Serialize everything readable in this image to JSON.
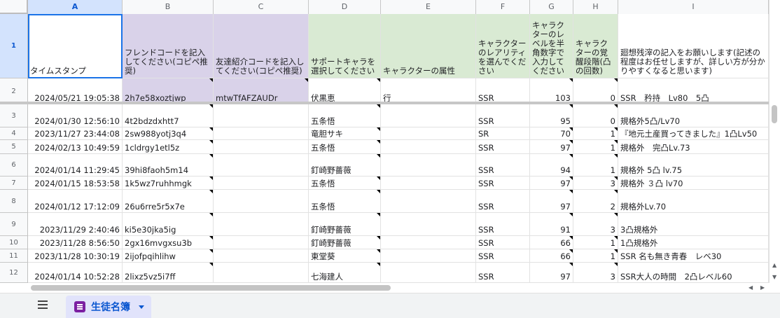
{
  "columns": [
    "A",
    "B",
    "C",
    "D",
    "E",
    "F",
    "G",
    "H",
    "I"
  ],
  "header_row": {
    "row_number": "1",
    "cells": [
      "タイムスタンプ",
      "フレンドコードを記入してください(コピペ推奨)",
      "友達紹介コードを記入してください(コピペ推奨)",
      "サポートキャラを選択してください",
      "キャラクターの属性",
      "キャラクターのレアリティを選んでください",
      "キャラクターのレベルを半角数字で入力してください",
      "キャラクターの覚醒段階(凸の回数)",
      "廻想残滓の記入をお願いします(記述の程度はお任せしますが、詳しい方が分かりやすくなると思います)"
    ]
  },
  "rows": [
    {
      "n": "2",
      "ts": "2024/05/21 19:05:38",
      "friend": "2h7e58xoztjwp",
      "referral": "mtwTfAFZAUDr",
      "chara": "伏黒恵",
      "attr": "行",
      "rarity": "SSR",
      "level": "103",
      "awaken": "0",
      "memo": "SSR　矜持　Lv80　5凸"
    },
    {
      "n": "3",
      "ts": "2024/01/30 12:56:10",
      "friend": "4t2bdzdxhtt7",
      "referral": "",
      "chara": "五条悟",
      "attr": "",
      "rarity": "SSR",
      "level": "95",
      "awaken": "0",
      "memo": "規格外5凸/Lv70"
    },
    {
      "n": "4",
      "ts": "2023/11/27 23:44:08",
      "friend": "2sw988yotj3q4",
      "referral": "",
      "chara": "竜胆サキ",
      "attr": "",
      "rarity": "SR",
      "level": "70",
      "awaken": "1",
      "memo": "『地元土産買ってきました』1凸Lv50"
    },
    {
      "n": "5",
      "ts": "2024/02/13 10:49:59",
      "friend": "1cldrgy1etl5z",
      "referral": "",
      "chara": "五条悟",
      "attr": "",
      "rarity": "SSR",
      "level": "97",
      "awaken": "1",
      "memo": "規格外　完凸Lv.73"
    },
    {
      "n": "6",
      "ts": "2024/01/14 11:29:45",
      "friend": "39hi8faoh5m14",
      "referral": "",
      "chara": "釘崎野薔薇",
      "attr": "",
      "rarity": "SSR",
      "level": "94",
      "awaken": "1",
      "memo": "規格外 5凸 lv.75"
    },
    {
      "n": "7",
      "ts": "2024/01/15 18:53:58",
      "friend": "1k5wz7ruhhmgk",
      "referral": "",
      "chara": "五条悟",
      "attr": "",
      "rarity": "SSR",
      "level": "97",
      "awaken": "3",
      "memo": "規格外 ３凸 lv70"
    },
    {
      "n": "8",
      "ts": "2024/01/12 17:12:09",
      "friend": "26u6rre5r5x7e",
      "referral": "",
      "chara": "五条悟",
      "attr": "",
      "rarity": "SSR",
      "level": "97",
      "awaken": "2",
      "memo": "規格外Lv.70"
    },
    {
      "n": "9",
      "ts": "2023/11/29 2:40:46",
      "friend": "ki5e30jka5ig",
      "referral": "",
      "chara": "釘崎野薔薇",
      "attr": "",
      "rarity": "SSR",
      "level": "91",
      "awaken": "3",
      "memo": "3凸規格外"
    },
    {
      "n": "10",
      "ts": "2023/11/28 8:56:50",
      "friend": "2gx16mvgxsu3b",
      "referral": "",
      "chara": "釘崎野薔薇",
      "attr": "",
      "rarity": "SSR",
      "level": "66",
      "awaken": "1",
      "memo": "1凸規格外"
    },
    {
      "n": "11",
      "ts": "2023/11/28 10:30:19",
      "friend": "2ijofpqihlihw",
      "referral": "",
      "chara": "東堂葵",
      "attr": "",
      "rarity": "SSR",
      "level": "66",
      "awaken": "1",
      "memo": "SSR 名も無き青春　レベ30"
    },
    {
      "n": "12",
      "ts": "2024/01/14 10:52:28",
      "friend": "2lixz5vz5i7ff",
      "referral": "",
      "chara": "七海建人",
      "attr": "",
      "rarity": "SSR",
      "level": "97",
      "awaken": "3",
      "memo": "SSR大人の時間　2凸レベル60"
    }
  ],
  "sheet_tab": {
    "label": "生徒名簿"
  },
  "colors": {
    "purple_header": "#d9d2e9",
    "green_header": "#d9ead3",
    "selection": "#1a73e8"
  }
}
